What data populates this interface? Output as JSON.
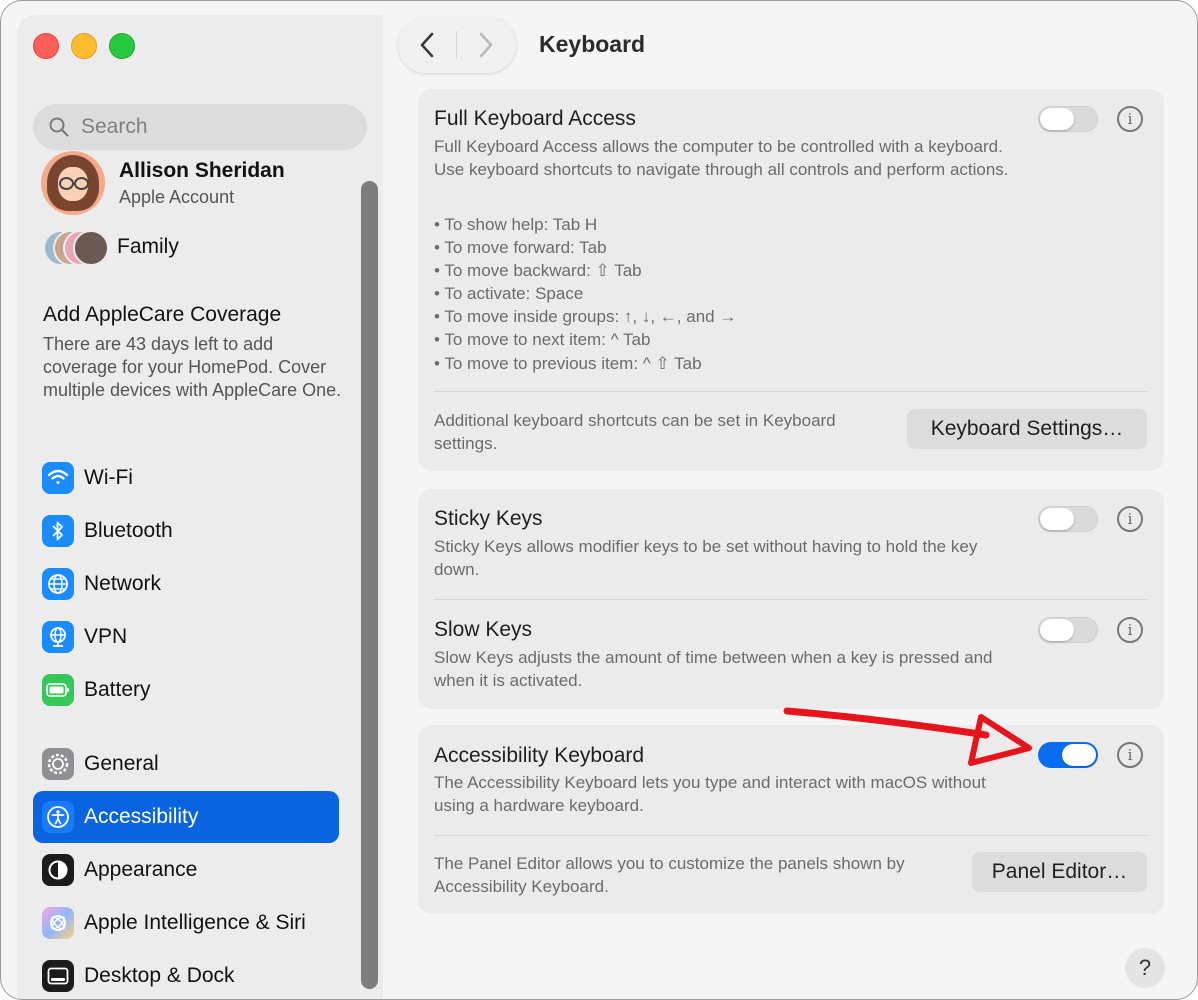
{
  "window": {
    "traffic_lights": [
      "close",
      "minimize",
      "zoom"
    ]
  },
  "sidebar": {
    "search_placeholder": "Search",
    "profile": {
      "name": "Allison Sheridan",
      "subtitle": "Apple Account"
    },
    "family": {
      "label": "Family"
    },
    "applecare": {
      "title": "Add AppleCare Coverage",
      "description": "There are 43 days left to add coverage for your HomePod. Cover multiple devices with AppleCare One."
    },
    "items": [
      {
        "label": "Wi-Fi",
        "icon": "wifi-icon",
        "color": "#1a8cff"
      },
      {
        "label": "Bluetooth",
        "icon": "bluetooth-icon",
        "color": "#1a8cff"
      },
      {
        "label": "Network",
        "icon": "globe-icon",
        "color": "#1a8cff"
      },
      {
        "label": "VPN",
        "icon": "vpn-globe-icon",
        "color": "#1a8cff"
      },
      {
        "label": "Battery",
        "icon": "battery-icon",
        "color": "#35c759"
      },
      {
        "label": "General",
        "icon": "gear-icon",
        "color": "#8e8e93"
      },
      {
        "label": "Accessibility",
        "icon": "accessibility-icon",
        "color": "#0a64e0",
        "selected": true
      },
      {
        "label": "Appearance",
        "icon": "appearance-icon",
        "color": "#1c1c1e"
      },
      {
        "label": "Apple Intelligence & Siri",
        "icon": "siri-icon",
        "color": "#e85fd0"
      },
      {
        "label": "Desktop & Dock",
        "icon": "dock-icon",
        "color": "#1c1c1e"
      }
    ]
  },
  "toolbar": {
    "back_label": "‹",
    "forward_label": "›",
    "title": "Keyboard"
  },
  "full_keyboard_access": {
    "title": "Full Keyboard Access",
    "enabled": false,
    "description": "Full Keyboard Access allows the computer to be controlled with a keyboard. Use keyboard shortcuts to navigate through all controls and perform actions.",
    "shortcuts": [
      "• To show help: Tab H",
      "• To move forward: Tab",
      "• To move backward: ⇧ Tab",
      "• To activate: Space",
      "• To move inside groups: ↑, ↓, ←, and →",
      "• To move to next item: ^ Tab",
      "• To move to previous item: ^ ⇧ Tab"
    ],
    "footer_text": "Additional keyboard shortcuts can be set in Keyboard settings.",
    "button_label": "Keyboard Settings…"
  },
  "sticky_keys": {
    "title": "Sticky Keys",
    "enabled": false,
    "description": "Sticky Keys allows modifier keys to be set without having to hold the key down."
  },
  "slow_keys": {
    "title": "Slow Keys",
    "enabled": false,
    "description": "Slow Keys adjusts the amount of time between when a key is pressed and when it is activated."
  },
  "accessibility_keyboard": {
    "title": "Accessibility Keyboard",
    "enabled": true,
    "description": "The Accessibility Keyboard lets you type and interact with macOS without using a hardware keyboard.",
    "panel_text": "The Panel Editor allows you to customize the panels shown by Accessibility Keyboard.",
    "button_label": "Panel Editor…"
  },
  "info_glyph": "i",
  "help_label": "?",
  "colors": {
    "accent": "#0a64e0",
    "toggle_on": "#0a6df0",
    "annotation_arrow": "#e8141c"
  }
}
